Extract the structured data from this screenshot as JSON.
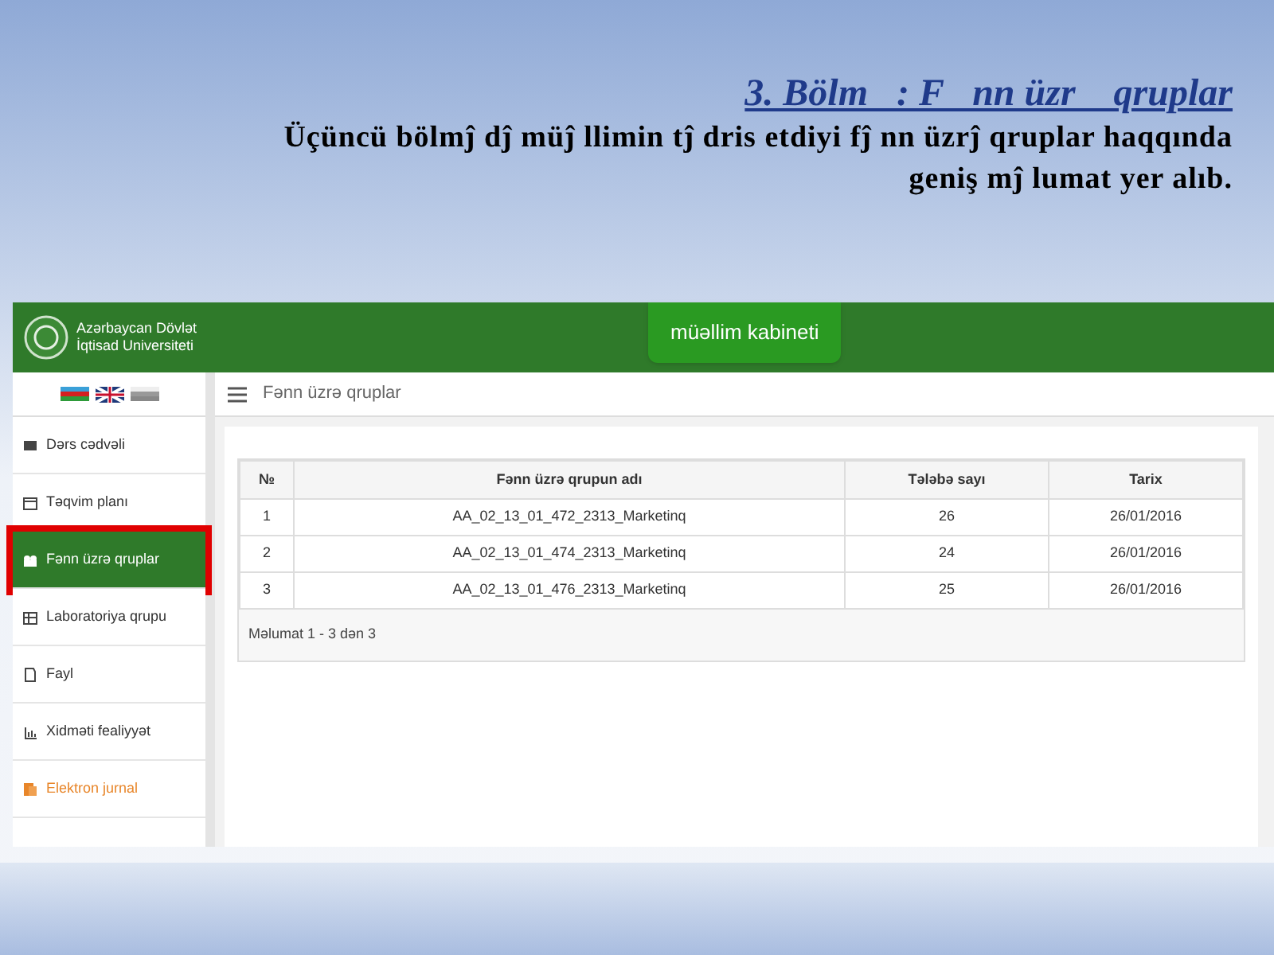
{
  "slide": {
    "title": "3. Bölm   : F   nn üzr    qruplar",
    "body": "Üçüncü bölmĵ dĵ  müĵ llimin tĵ dris etdiyi fĵ nn üzrĵ  qruplar haqqında geniş mĵ lumat yer alıb."
  },
  "app": {
    "logo_text": [
      "Azərbaycan Dövlət",
      "İqtisad Universiteti"
    ],
    "header_button": "müəllim kabineti",
    "breadcrumb": "Fənn üzrə qruplar",
    "sidebar": {
      "items": [
        {
          "label": "Dərs cədvəli",
          "kind": "normal",
          "selected": false,
          "annotated": false
        },
        {
          "label": "Təqvim planı",
          "kind": "normal",
          "selected": false,
          "annotated": false
        },
        {
          "label": "Fənn üzrə qruplar",
          "kind": "normal",
          "selected": true,
          "annotated": true
        },
        {
          "label": "Laboratoriya qrupu",
          "kind": "normal",
          "selected": false,
          "annotated": false
        },
        {
          "label": "Fayl",
          "kind": "normal",
          "selected": false,
          "annotated": false
        },
        {
          "label": "Xidməti fealiyyət",
          "kind": "normal",
          "selected": false,
          "annotated": false
        },
        {
          "label": "Elektron jurnal",
          "kind": "accent",
          "selected": false,
          "annotated": false
        }
      ]
    },
    "table": {
      "columns": [
        "№",
        "Fənn üzrə qrupun adı",
        "Tələbə sayı",
        "Tarix"
      ],
      "rows": [
        [
          "1",
          "AA_02_13_01_472_2313_Marketinq",
          "26",
          "26/01/2016"
        ],
        [
          "2",
          "AA_02_13_01_474_2313_Marketinq",
          "24",
          "26/01/2016"
        ],
        [
          "3",
          "AA_02_13_01_476_2313_Marketinq",
          "25",
          "26/01/2016"
        ]
      ],
      "footer": "Məlumat 1 - 3 dən 3"
    }
  }
}
